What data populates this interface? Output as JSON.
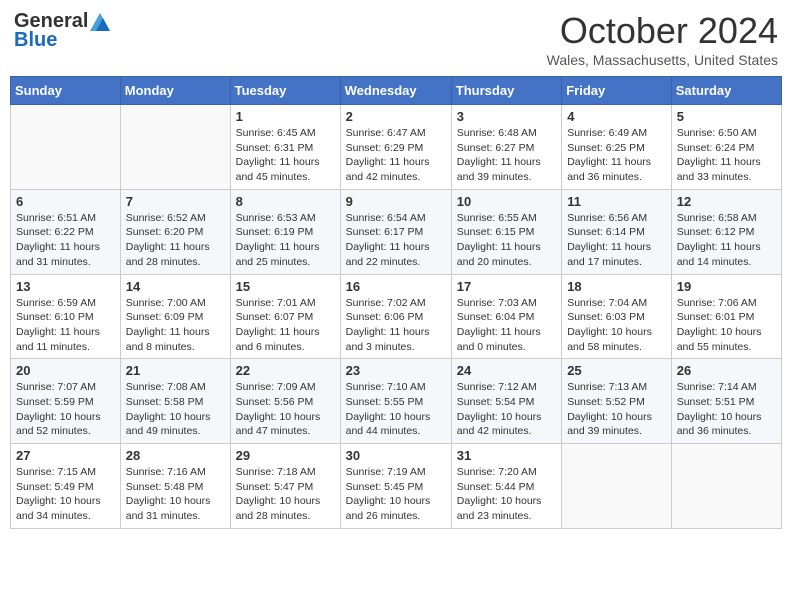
{
  "header": {
    "logo_line1": "General",
    "logo_line2": "Blue",
    "month": "October 2024",
    "location": "Wales, Massachusetts, United States"
  },
  "weekdays": [
    "Sunday",
    "Monday",
    "Tuesday",
    "Wednesday",
    "Thursday",
    "Friday",
    "Saturday"
  ],
  "weeks": [
    [
      {
        "day": "",
        "info": ""
      },
      {
        "day": "",
        "info": ""
      },
      {
        "day": "1",
        "info": "Sunrise: 6:45 AM\nSunset: 6:31 PM\nDaylight: 11 hours and 45 minutes."
      },
      {
        "day": "2",
        "info": "Sunrise: 6:47 AM\nSunset: 6:29 PM\nDaylight: 11 hours and 42 minutes."
      },
      {
        "day": "3",
        "info": "Sunrise: 6:48 AM\nSunset: 6:27 PM\nDaylight: 11 hours and 39 minutes."
      },
      {
        "day": "4",
        "info": "Sunrise: 6:49 AM\nSunset: 6:25 PM\nDaylight: 11 hours and 36 minutes."
      },
      {
        "day": "5",
        "info": "Sunrise: 6:50 AM\nSunset: 6:24 PM\nDaylight: 11 hours and 33 minutes."
      }
    ],
    [
      {
        "day": "6",
        "info": "Sunrise: 6:51 AM\nSunset: 6:22 PM\nDaylight: 11 hours and 31 minutes."
      },
      {
        "day": "7",
        "info": "Sunrise: 6:52 AM\nSunset: 6:20 PM\nDaylight: 11 hours and 28 minutes."
      },
      {
        "day": "8",
        "info": "Sunrise: 6:53 AM\nSunset: 6:19 PM\nDaylight: 11 hours and 25 minutes."
      },
      {
        "day": "9",
        "info": "Sunrise: 6:54 AM\nSunset: 6:17 PM\nDaylight: 11 hours and 22 minutes."
      },
      {
        "day": "10",
        "info": "Sunrise: 6:55 AM\nSunset: 6:15 PM\nDaylight: 11 hours and 20 minutes."
      },
      {
        "day": "11",
        "info": "Sunrise: 6:56 AM\nSunset: 6:14 PM\nDaylight: 11 hours and 17 minutes."
      },
      {
        "day": "12",
        "info": "Sunrise: 6:58 AM\nSunset: 6:12 PM\nDaylight: 11 hours and 14 minutes."
      }
    ],
    [
      {
        "day": "13",
        "info": "Sunrise: 6:59 AM\nSunset: 6:10 PM\nDaylight: 11 hours and 11 minutes."
      },
      {
        "day": "14",
        "info": "Sunrise: 7:00 AM\nSunset: 6:09 PM\nDaylight: 11 hours and 8 minutes."
      },
      {
        "day": "15",
        "info": "Sunrise: 7:01 AM\nSunset: 6:07 PM\nDaylight: 11 hours and 6 minutes."
      },
      {
        "day": "16",
        "info": "Sunrise: 7:02 AM\nSunset: 6:06 PM\nDaylight: 11 hours and 3 minutes."
      },
      {
        "day": "17",
        "info": "Sunrise: 7:03 AM\nSunset: 6:04 PM\nDaylight: 11 hours and 0 minutes."
      },
      {
        "day": "18",
        "info": "Sunrise: 7:04 AM\nSunset: 6:03 PM\nDaylight: 10 hours and 58 minutes."
      },
      {
        "day": "19",
        "info": "Sunrise: 7:06 AM\nSunset: 6:01 PM\nDaylight: 10 hours and 55 minutes."
      }
    ],
    [
      {
        "day": "20",
        "info": "Sunrise: 7:07 AM\nSunset: 5:59 PM\nDaylight: 10 hours and 52 minutes."
      },
      {
        "day": "21",
        "info": "Sunrise: 7:08 AM\nSunset: 5:58 PM\nDaylight: 10 hours and 49 minutes."
      },
      {
        "day": "22",
        "info": "Sunrise: 7:09 AM\nSunset: 5:56 PM\nDaylight: 10 hours and 47 minutes."
      },
      {
        "day": "23",
        "info": "Sunrise: 7:10 AM\nSunset: 5:55 PM\nDaylight: 10 hours and 44 minutes."
      },
      {
        "day": "24",
        "info": "Sunrise: 7:12 AM\nSunset: 5:54 PM\nDaylight: 10 hours and 42 minutes."
      },
      {
        "day": "25",
        "info": "Sunrise: 7:13 AM\nSunset: 5:52 PM\nDaylight: 10 hours and 39 minutes."
      },
      {
        "day": "26",
        "info": "Sunrise: 7:14 AM\nSunset: 5:51 PM\nDaylight: 10 hours and 36 minutes."
      }
    ],
    [
      {
        "day": "27",
        "info": "Sunrise: 7:15 AM\nSunset: 5:49 PM\nDaylight: 10 hours and 34 minutes."
      },
      {
        "day": "28",
        "info": "Sunrise: 7:16 AM\nSunset: 5:48 PM\nDaylight: 10 hours and 31 minutes."
      },
      {
        "day": "29",
        "info": "Sunrise: 7:18 AM\nSunset: 5:47 PM\nDaylight: 10 hours and 28 minutes."
      },
      {
        "day": "30",
        "info": "Sunrise: 7:19 AM\nSunset: 5:45 PM\nDaylight: 10 hours and 26 minutes."
      },
      {
        "day": "31",
        "info": "Sunrise: 7:20 AM\nSunset: 5:44 PM\nDaylight: 10 hours and 23 minutes."
      },
      {
        "day": "",
        "info": ""
      },
      {
        "day": "",
        "info": ""
      }
    ]
  ]
}
